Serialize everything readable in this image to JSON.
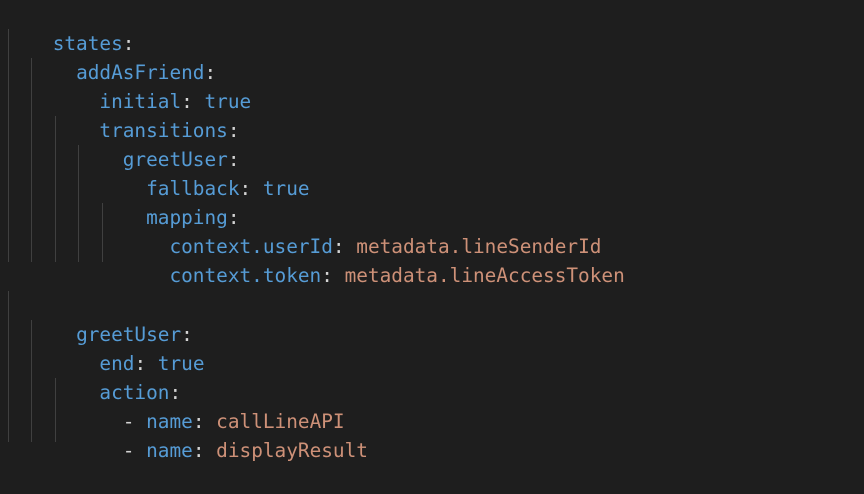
{
  "code": {
    "lines": [
      {
        "key": "states",
        "sep": ":"
      },
      {
        "key": "addAsFriend",
        "sep": ":"
      },
      {
        "key": "initial",
        "sep": ": ",
        "value": "true"
      },
      {
        "key": "transitions",
        "sep": ":"
      },
      {
        "key": "greetUser",
        "sep": ":"
      },
      {
        "key": "fallback",
        "sep": ": ",
        "value": "true"
      },
      {
        "key": "mapping",
        "sep": ":"
      },
      {
        "key": "context.userId",
        "sep": ": ",
        "value": "metadata.lineSenderId"
      },
      {
        "key": "context.token",
        "sep": ": ",
        "value": "metadata.lineAccessToken"
      },
      {
        "key": "greetUser",
        "sep": ":"
      },
      {
        "key": "end",
        "sep": ": ",
        "value": "true"
      },
      {
        "key": "action",
        "sep": ":"
      },
      {
        "dash": "- ",
        "key": "name",
        "sep": ": ",
        "value": "callLineAPI"
      },
      {
        "dash": "- ",
        "key": "name",
        "sep": ": ",
        "value": "displayResult"
      }
    ]
  },
  "colors": {
    "background": "#1e1e1e",
    "key": "#569cd6",
    "boolean": "#569cd6",
    "string": "#ce9178",
    "punctuation": "#d4d4d4",
    "indent_guide": "#404040"
  }
}
